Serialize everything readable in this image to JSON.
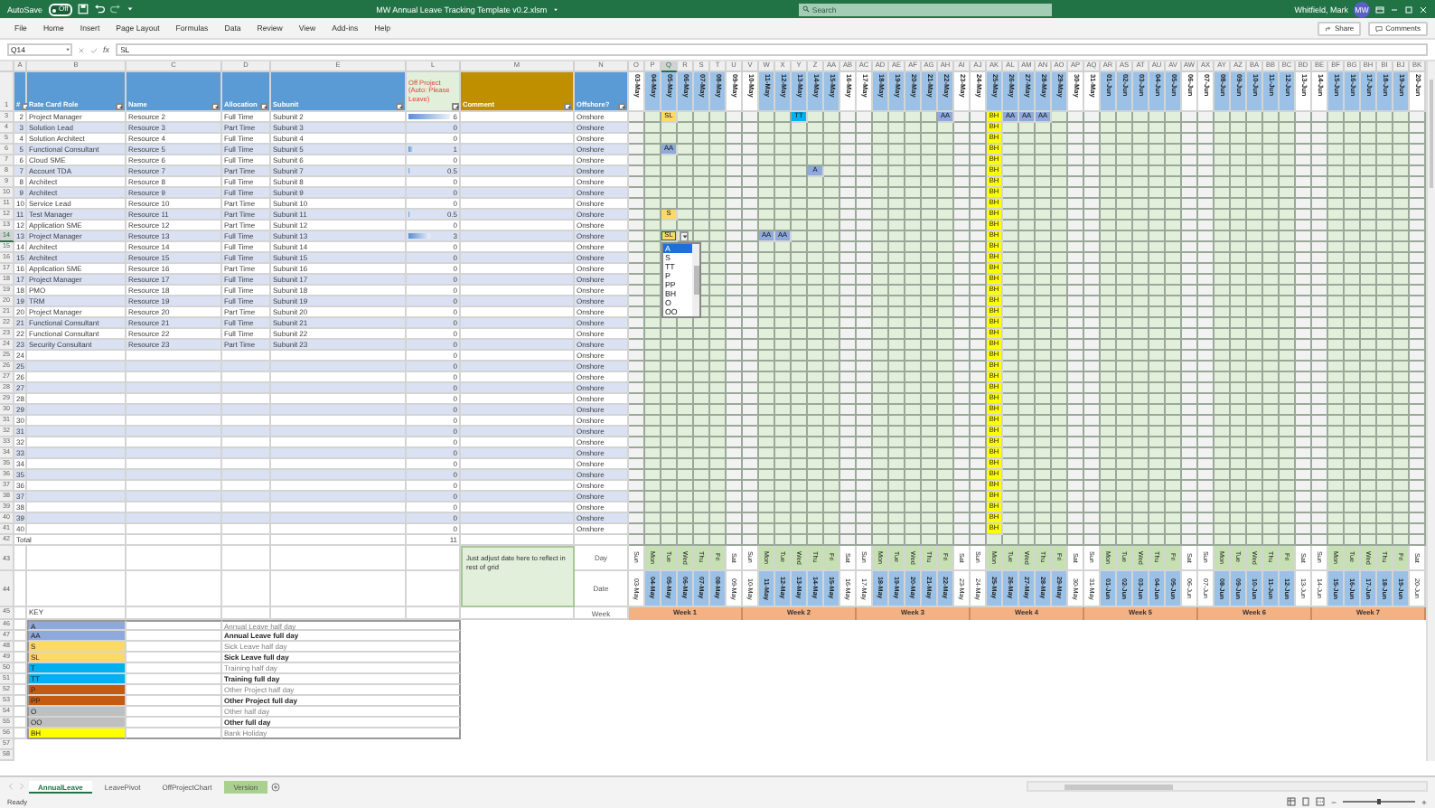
{
  "window": {
    "title": "MW Annual Leave Tracking Template v0.2.xlsm"
  },
  "autosave": {
    "label": "AutoSave",
    "value": "Off",
    "on": false
  },
  "search": {
    "placeholder": "Search"
  },
  "user": {
    "name": "Whitfield, Mark",
    "initials": "MW"
  },
  "menu": [
    "File",
    "Home",
    "Insert",
    "Page Layout",
    "Formulas",
    "Data",
    "Review",
    "View",
    "Add-ins",
    "Help"
  ],
  "share": "Share",
  "comments": "Comments",
  "formula_bar": {
    "name_box": "Q14",
    "fx": "fx",
    "value": "SL"
  },
  "corner_row": "1",
  "columns": [
    {
      "letter": "A",
      "title": "#"
    },
    {
      "letter": "B",
      "title": "Rate Card Role"
    },
    {
      "letter": "C",
      "title": "Name"
    },
    {
      "letter": "D",
      "title": "Allocation"
    },
    {
      "letter": "E",
      "title": "Subunit"
    },
    {
      "letter": "L",
      "title": "Off Project (Auto: Please Leave)"
    },
    {
      "letter": "M",
      "title": "Comment"
    },
    {
      "letter": "N",
      "title": "Offshore?"
    }
  ],
  "dates": [
    {
      "letter": "O",
      "date": "03-May",
      "weekend": true
    },
    {
      "letter": "P",
      "date": "04-May",
      "weekend": false
    },
    {
      "letter": "Q",
      "date": "05-May",
      "weekend": false
    },
    {
      "letter": "R",
      "date": "06-May",
      "weekend": false
    },
    {
      "letter": "S",
      "date": "07-May",
      "weekend": false
    },
    {
      "letter": "T",
      "date": "08-May",
      "weekend": false
    },
    {
      "letter": "U",
      "date": "09-May",
      "weekend": true
    },
    {
      "letter": "V",
      "date": "10-May",
      "weekend": true
    },
    {
      "letter": "W",
      "date": "11-May",
      "weekend": false
    },
    {
      "letter": "X",
      "date": "12-May",
      "weekend": false
    },
    {
      "letter": "Y",
      "date": "13-May",
      "weekend": false
    },
    {
      "letter": "Z",
      "date": "14-May",
      "weekend": false
    },
    {
      "letter": "AA",
      "date": "15-May",
      "weekend": false
    },
    {
      "letter": "AB",
      "date": "16-May",
      "weekend": true
    },
    {
      "letter": "AC",
      "date": "17-May",
      "weekend": true
    },
    {
      "letter": "AD",
      "date": "18-May",
      "weekend": false
    },
    {
      "letter": "AE",
      "date": "19-May",
      "weekend": false
    },
    {
      "letter": "AF",
      "date": "20-May",
      "weekend": false
    },
    {
      "letter": "AG",
      "date": "21-May",
      "weekend": false
    },
    {
      "letter": "AH",
      "date": "22-May",
      "weekend": false
    },
    {
      "letter": "AI",
      "date": "23-May",
      "weekend": true
    },
    {
      "letter": "AJ",
      "date": "24-May",
      "weekend": true
    },
    {
      "letter": "AK",
      "date": "25-May",
      "weekend": false
    },
    {
      "letter": "AL",
      "date": "26-May",
      "weekend": false
    },
    {
      "letter": "AM",
      "date": "27-May",
      "weekend": false
    },
    {
      "letter": "AN",
      "date": "28-May",
      "weekend": false
    },
    {
      "letter": "AO",
      "date": "29-May",
      "weekend": false
    },
    {
      "letter": "AP",
      "date": "30-May",
      "weekend": true
    },
    {
      "letter": "AQ",
      "date": "31-May",
      "weekend": true
    },
    {
      "letter": "AR",
      "date": "01-Jun",
      "weekend": false
    },
    {
      "letter": "AS",
      "date": "02-Jun",
      "weekend": false
    },
    {
      "letter": "AT",
      "date": "03-Jun",
      "weekend": false
    },
    {
      "letter": "AU",
      "date": "04-Jun",
      "weekend": false
    },
    {
      "letter": "AV",
      "date": "05-Jun",
      "weekend": false
    },
    {
      "letter": "AW",
      "date": "06-Jun",
      "weekend": true
    },
    {
      "letter": "AX",
      "date": "07-Jun",
      "weekend": true
    },
    {
      "letter": "AY",
      "date": "08-Jun",
      "weekend": false
    },
    {
      "letter": "AZ",
      "date": "09-Jun",
      "weekend": false
    },
    {
      "letter": "BA",
      "date": "10-Jun",
      "weekend": false
    },
    {
      "letter": "BB",
      "date": "11-Jun",
      "weekend": false
    },
    {
      "letter": "BC",
      "date": "12-Jun",
      "weekend": false
    },
    {
      "letter": "BD",
      "date": "13-Jun",
      "weekend": true
    },
    {
      "letter": "BE",
      "date": "14-Jun",
      "weekend": true
    },
    {
      "letter": "BF",
      "date": "15-Jun",
      "weekend": false
    },
    {
      "letter": "BG",
      "date": "16-Jun",
      "weekend": false
    },
    {
      "letter": "BH",
      "date": "17-Jun",
      "weekend": false
    },
    {
      "letter": "BI",
      "date": "18-Jun",
      "weekend": false
    },
    {
      "letter": "BJ",
      "date": "19-Jun",
      "weekend": false
    },
    {
      "letter": "BK",
      "date": "20-Jun",
      "weekend": true
    }
  ],
  "rows": [
    {
      "row": "3",
      "n": "2",
      "role": "Project Manager",
      "name": "Resource 2",
      "allocation": "Full Time",
      "subunit": "Subunit 2",
      "off": "6",
      "level": 0.85,
      "offshore": "Onshore",
      "leave": {
        "Q": {
          "code": "SL",
          "color": "#ffd966"
        },
        "Y": {
          "code": "TT",
          "color": "#00b0f0"
        },
        "AH": {
          "code": "AA",
          "color": "#8ea9db"
        },
        "AK": {
          "code": "BH",
          "color": "#ffff00"
        },
        "AL": {
          "code": "AA",
          "color": "#8ea9db"
        },
        "AM": {
          "code": "AA",
          "color": "#8ea9db"
        },
        "AN": {
          "code": "AA",
          "color": "#8ea9db"
        }
      }
    },
    {
      "row": "4",
      "n": "3",
      "role": "Solution Lead",
      "name": "Resource 3",
      "allocation": "Part Time",
      "subunit": "Subunit 3",
      "off": "0",
      "offshore": "Onshore",
      "leave": {
        "AK": {
          "code": "BH",
          "color": "#ffff00"
        }
      }
    },
    {
      "row": "5",
      "n": "4",
      "role": "Solution Architect",
      "name": "Resource 4",
      "allocation": "Full Time",
      "subunit": "Subunit 4",
      "off": "0",
      "offshore": "Onshore",
      "leave": {
        "AK": {
          "code": "BH",
          "color": "#ffff00"
        }
      }
    },
    {
      "row": "6",
      "n": "5",
      "role": "Functional Consultant",
      "name": "Resource 5",
      "allocation": "Full Time",
      "subunit": "Subunit 5",
      "off": "1",
      "level": 0.14,
      "offshore": "Onshore",
      "leave": {
        "Q": {
          "code": "AA",
          "color": "#8ea9db"
        },
        "AK": {
          "code": "BH",
          "color": "#ffff00"
        }
      }
    },
    {
      "row": "7",
      "n": "6",
      "role": "Cloud SME",
      "name": "Resource 6",
      "allocation": "Full Time",
      "subunit": "Subunit 6",
      "off": "0",
      "offshore": "Onshore",
      "leave": {
        "AK": {
          "code": "BH",
          "color": "#ffff00"
        }
      }
    },
    {
      "row": "8",
      "n": "7",
      "role": "Account TDA",
      "name": "Resource 7",
      "allocation": "Part Time",
      "subunit": "Subunit 7",
      "off": "0.5",
      "level": 0.07,
      "offshore": "Onshore",
      "leave": {
        "Z": {
          "code": "A",
          "color": "#8ea9db"
        },
        "AK": {
          "code": "BH",
          "color": "#ffff00"
        }
      }
    },
    {
      "row": "9",
      "n": "8",
      "role": "Architect",
      "name": "Resource 8",
      "allocation": "Full Time",
      "subunit": "Subunit 8",
      "off": "0",
      "offshore": "Onshore",
      "leave": {
        "AK": {
          "code": "BH",
          "color": "#ffff00"
        }
      }
    },
    {
      "row": "10",
      "n": "9",
      "role": "Architect",
      "name": "Resource 9",
      "allocation": "Full Time",
      "subunit": "Subunit 9",
      "off": "0",
      "offshore": "Onshore",
      "leave": {
        "AK": {
          "code": "BH",
          "color": "#ffff00"
        }
      }
    },
    {
      "row": "11",
      "n": "10",
      "role": "Service Lead",
      "name": "Resource 10",
      "allocation": "Part Time",
      "subunit": "Subunit 10",
      "off": "0",
      "offshore": "Onshore",
      "leave": {
        "AK": {
          "code": "BH",
          "color": "#ffff00"
        }
      }
    },
    {
      "row": "12",
      "n": "11",
      "role": "Test Manager",
      "name": "Resource 11",
      "allocation": "Part Time",
      "subunit": "Subunit 11",
      "off": "0.5",
      "level": 0.07,
      "offshore": "Onshore",
      "leave": {
        "Q": {
          "code": "S",
          "color": "#ffd966"
        },
        "AK": {
          "code": "BH",
          "color": "#ffff00"
        }
      }
    },
    {
      "row": "13",
      "n": "12",
      "role": "Application SME",
      "name": "Resource 12",
      "allocation": "Part Time",
      "subunit": "Subunit 12",
      "off": "0",
      "offshore": "Onshore",
      "leave": {
        "AK": {
          "code": "BH",
          "color": "#ffff00"
        }
      }
    },
    {
      "row": "14",
      "n": "13",
      "role": "Project Manager",
      "name": "Resource 13",
      "allocation": "Full Time",
      "subunit": "Subunit 13",
      "off": "3",
      "level": 0.45,
      "offshore": "Onshore",
      "leave": {
        "Q": {
          "code": "SL",
          "color": "#ffd966",
          "selected": true,
          "dropdown": [
            {
              "label": "A",
              "selected": true
            },
            {
              "label": "S",
              "selected": false
            },
            {
              "label": "TT",
              "selected": false
            },
            {
              "label": "P",
              "selected": false
            },
            {
              "label": "PP",
              "selected": false
            },
            {
              "label": "BH",
              "selected": false
            },
            {
              "label": "O",
              "selected": false
            },
            {
              "label": "OO",
              "selected": false
            }
          ]
        },
        "W": {
          "code": "AA",
          "color": "#8ea9db"
        },
        "X": {
          "code": "AA",
          "color": "#8ea9db"
        },
        "AK": {
          "code": "BH",
          "color": "#ffff00"
        }
      }
    },
    {
      "row": "15",
      "n": "14",
      "role": "Architect",
      "name": "Resource 14",
      "allocation": "Full Time",
      "subunit": "Subunit 14",
      "off": "0",
      "offshore": "Onshore",
      "leave": {
        "AK": {
          "code": "BH",
          "color": "#ffff00"
        }
      }
    },
    {
      "row": "16",
      "n": "15",
      "role": "Architect",
      "name": "Resource 15",
      "allocation": "Full Time",
      "subunit": "Subunit 15",
      "off": "0",
      "offshore": "Onshore",
      "leave": {
        "AK": {
          "code": "BH",
          "color": "#ffff00"
        }
      }
    },
    {
      "row": "17",
      "n": "16",
      "role": "Application SME",
      "name": "Resource 16",
      "allocation": "Part Time",
      "subunit": "Subunit 16",
      "off": "0",
      "offshore": "Onshore",
      "leave": {
        "AK": {
          "code": "BH",
          "color": "#ffff00"
        }
      }
    },
    {
      "row": "18",
      "n": "17",
      "role": "Project Manager",
      "name": "Resource 17",
      "allocation": "Full Time",
      "subunit": "Subunit 17",
      "off": "0",
      "offshore": "Onshore",
      "leave": {
        "AK": {
          "code": "BH",
          "color": "#ffff00"
        }
      }
    },
    {
      "row": "19",
      "n": "18",
      "role": "PMO",
      "name": "Resource 18",
      "allocation": "Full Time",
      "subunit": "Subunit 18",
      "off": "0",
      "offshore": "Onshore",
      "leave": {
        "AK": {
          "code": "BH",
          "color": "#ffff00"
        }
      }
    },
    {
      "row": "20",
      "n": "19",
      "role": "TRM",
      "name": "Resource 19",
      "allocation": "Full Time",
      "subunit": "Subunit 19",
      "off": "0",
      "offshore": "Onshore",
      "leave": {
        "AK": {
          "code": "BH",
          "color": "#ffff00"
        }
      }
    },
    {
      "row": "21",
      "n": "20",
      "role": "Project Manager",
      "name": "Resource 20",
      "allocation": "Part Time",
      "subunit": "Subunit 20",
      "off": "0",
      "offshore": "Onshore",
      "leave": {
        "AK": {
          "code": "BH",
          "color": "#ffff00"
        }
      }
    },
    {
      "row": "22",
      "n": "21",
      "role": "Functional Consultant",
      "name": "Resource 21",
      "allocation": "Full Time",
      "subunit": "Subunit 21",
      "off": "0",
      "offshore": "Onshore",
      "leave": {
        "AK": {
          "code": "BH",
          "color": "#ffff00"
        }
      }
    },
    {
      "row": "23",
      "n": "22",
      "role": "Functional Consultant",
      "name": "Resource 22",
      "allocation": "Full Time",
      "subunit": "Subunit 22",
      "off": "0",
      "offshore": "Onshore",
      "leave": {
        "AK": {
          "code": "BH",
          "color": "#ffff00"
        }
      }
    },
    {
      "row": "24",
      "n": "23",
      "role": "Security Consultant",
      "name": "Resource 23",
      "allocation": "Part Time",
      "subunit": "Subunit 23",
      "off": "0",
      "offshore": "Onshore",
      "leave": {
        "AK": {
          "code": "BH",
          "color": "#ffff00"
        }
      }
    },
    {
      "row": "25",
      "n": "24",
      "off": "0",
      "offshore": "Onshore",
      "leave": {
        "AK": {
          "code": "BH",
          "color": "#ffff00"
        }
      }
    },
    {
      "row": "26",
      "n": "25",
      "off": "0",
      "offshore": "Onshore",
      "leave": {
        "AK": {
          "code": "BH",
          "color": "#ffff00"
        }
      }
    },
    {
      "row": "27",
      "n": "26",
      "off": "0",
      "offshore": "Onshore",
      "leave": {
        "AK": {
          "code": "BH",
          "color": "#ffff00"
        }
      }
    },
    {
      "row": "28",
      "n": "27",
      "off": "0",
      "offshore": "Onshore",
      "leave": {
        "AK": {
          "code": "BH",
          "color": "#ffff00"
        }
      }
    },
    {
      "row": "29",
      "n": "28",
      "off": "0",
      "offshore": "Onshore",
      "leave": {
        "AK": {
          "code": "BH",
          "color": "#ffff00"
        }
      }
    },
    {
      "row": "30",
      "n": "29",
      "off": "0",
      "offshore": "Onshore",
      "leave": {
        "AK": {
          "code": "BH",
          "color": "#ffff00"
        }
      }
    },
    {
      "row": "31",
      "n": "30",
      "off": "0",
      "offshore": "Onshore",
      "leave": {
        "AK": {
          "code": "BH",
          "color": "#ffff00"
        }
      }
    },
    {
      "row": "32",
      "n": "31",
      "off": "0",
      "offshore": "Onshore",
      "leave": {
        "AK": {
          "code": "BH",
          "color": "#ffff00"
        }
      }
    },
    {
      "row": "33",
      "n": "32",
      "off": "0",
      "offshore": "Onshore",
      "leave": {
        "AK": {
          "code": "BH",
          "color": "#ffff00"
        }
      }
    },
    {
      "row": "34",
      "n": "33",
      "off": "0",
      "offshore": "Onshore",
      "leave": {
        "AK": {
          "code": "BH",
          "color": "#ffff00"
        }
      }
    },
    {
      "row": "35",
      "n": "34",
      "off": "0",
      "offshore": "Onshore",
      "leave": {
        "AK": {
          "code": "BH",
          "color": "#ffff00"
        }
      }
    },
    {
      "row": "36",
      "n": "35",
      "off": "0",
      "offshore": "Onshore",
      "leave": {
        "AK": {
          "code": "BH",
          "color": "#ffff00"
        }
      }
    },
    {
      "row": "37",
      "n": "36",
      "off": "0",
      "offshore": "Onshore",
      "leave": {
        "AK": {
          "code": "BH",
          "color": "#ffff00"
        }
      }
    },
    {
      "row": "38",
      "n": "37",
      "off": "0",
      "offshore": "Onshore",
      "leave": {
        "AK": {
          "code": "BH",
          "color": "#ffff00"
        }
      }
    },
    {
      "row": "39",
      "n": "38",
      "off": "0",
      "offshore": "Onshore",
      "leave": {
        "AK": {
          "code": "BH",
          "color": "#ffff00"
        }
      }
    },
    {
      "row": "40",
      "n": "39",
      "off": "0",
      "offshore": "Onshore",
      "leave": {
        "AK": {
          "code": "BH",
          "color": "#ffff00"
        }
      }
    },
    {
      "row": "41",
      "n": "40",
      "off": "0",
      "offshore": "Onshore",
      "leave": {
        "AK": {
          "code": "BH",
          "color": "#ffff00"
        }
      }
    }
  ],
  "total": {
    "row": "42",
    "label": "Total",
    "value": "11"
  },
  "footer": {
    "rows": [
      "43",
      "44",
      "45"
    ],
    "note": "Just adjust date here to reflect in rest of grid",
    "day_label": "Day",
    "date_label": "Date",
    "week_label": "Week",
    "days": [
      {
        "day": "Sun",
        "weekend": true
      },
      {
        "day": "Mon",
        "weekend": false
      },
      {
        "day": "Tue",
        "weekend": false
      },
      {
        "day": "Wed",
        "weekend": false
      },
      {
        "day": "Thu",
        "weekend": false
      },
      {
        "day": "Fri",
        "weekend": false
      },
      {
        "day": "Sat",
        "weekend": true
      },
      {
        "day": "Sun",
        "weekend": true
      },
      {
        "day": "Mon",
        "weekend": false
      },
      {
        "day": "Tue",
        "weekend": false
      },
      {
        "day": "Wed",
        "weekend": false
      },
      {
        "day": "Thu",
        "weekend": false
      },
      {
        "day": "Fri",
        "weekend": false
      },
      {
        "day": "Sat",
        "weekend": true
      },
      {
        "day": "Sun",
        "weekend": true
      },
      {
        "day": "Mon",
        "weekend": false
      },
      {
        "day": "Tue",
        "weekend": false
      },
      {
        "day": "Wed",
        "weekend": false
      },
      {
        "day": "Thu",
        "weekend": false
      },
      {
        "day": "Fri",
        "weekend": false
      },
      {
        "day": "Sat",
        "weekend": true
      },
      {
        "day": "Sun",
        "weekend": true
      },
      {
        "day": "Mon",
        "weekend": false
      },
      {
        "day": "Tue",
        "weekend": false
      },
      {
        "day": "Wed",
        "weekend": false
      },
      {
        "day": "Thu",
        "weekend": false
      },
      {
        "day": "Fri",
        "weekend": false
      },
      {
        "day": "Sat",
        "weekend": true
      },
      {
        "day": "Sun",
        "weekend": true
      },
      {
        "day": "Mon",
        "weekend": false
      },
      {
        "day": "Tue",
        "weekend": false
      },
      {
        "day": "Wed",
        "weekend": false
      },
      {
        "day": "Thu",
        "weekend": false
      },
      {
        "day": "Fri",
        "weekend": false
      },
      {
        "day": "Sat",
        "weekend": true
      },
      {
        "day": "Sun",
        "weekend": true
      },
      {
        "day": "Mon",
        "weekend": false
      },
      {
        "day": "Tue",
        "weekend": false
      },
      {
        "day": "Wed",
        "weekend": false
      },
      {
        "day": "Thu",
        "weekend": false
      },
      {
        "day": "Fri",
        "weekend": false
      },
      {
        "day": "Sat",
        "weekend": true
      },
      {
        "day": "Sun",
        "weekend": true
      },
      {
        "day": "Mon",
        "weekend": false
      },
      {
        "day": "Tue",
        "weekend": false
      },
      {
        "day": "Wed",
        "weekend": false
      },
      {
        "day": "Thu",
        "weekend": false
      },
      {
        "day": "Fri",
        "weekend": false
      },
      {
        "day": "Sat",
        "weekend": true
      }
    ],
    "dates": [
      "03-May",
      "04-May",
      "05-May",
      "06-May",
      "07-May",
      "08-May",
      "09-May",
      "10-May",
      "11-May",
      "12-May",
      "13-May",
      "14-May",
      "15-May",
      "16-May",
      "17-May",
      "18-May",
      "19-May",
      "20-May",
      "21-May",
      "22-May",
      "23-May",
      "24-May",
      "25-May",
      "26-May",
      "27-May",
      "28-May",
      "29-May",
      "30-May",
      "31-May",
      "01-Jun",
      "02-Jun",
      "03-Jun",
      "04-Jun",
      "05-Jun",
      "06-Jun",
      "07-Jun",
      "08-Jun",
      "09-Jun",
      "10-Jun",
      "11-Jun",
      "12-Jun",
      "13-Jun",
      "14-Jun",
      "15-Jun",
      "16-Jun",
      "17-Jun",
      "18-Jun",
      "19-Jun",
      "20-Jun"
    ],
    "weeks": [
      "Week 1",
      "Week 2",
      "Week 3",
      "Week 4",
      "Week 5",
      "Week 6",
      "Week 7"
    ]
  },
  "key": {
    "label": "KEY",
    "items": [
      {
        "row": "46",
        "code": "A",
        "color": "#8ea9db",
        "label": "Annual Leave half day",
        "full": false
      },
      {
        "row": "47",
        "code": "AA",
        "color": "#8ea9db",
        "label": "Annual Leave full day",
        "full": true
      },
      {
        "row": "48",
        "code": "S",
        "color": "#ffd966",
        "label": "Sick Leave half day",
        "full": false
      },
      {
        "row": "49",
        "code": "SL",
        "color": "#ffd966",
        "label": "Sick Leave full day",
        "full": true
      },
      {
        "row": "50",
        "code": "T",
        "color": "#00b0f0",
        "label": "Training half day",
        "full": false
      },
      {
        "row": "51",
        "code": "TT",
        "color": "#00b0f0",
        "label": "Training full day",
        "full": true
      },
      {
        "row": "52",
        "code": "P",
        "color": "#c55a11",
        "label": "Other Project half day",
        "full": false
      },
      {
        "row": "53",
        "code": "PP",
        "color": "#c55a11",
        "label": "Other Project full day",
        "full": true
      },
      {
        "row": "54",
        "code": "O",
        "color": "#bfbfbf",
        "label": "Other half day",
        "full": false
      },
      {
        "row": "55",
        "code": "OO",
        "color": "#bfbfbf",
        "label": "Other full day",
        "full": true
      },
      {
        "row": "56",
        "code": "BH",
        "color": "#ffff00",
        "label": "Bank Holiday",
        "full": false
      }
    ]
  },
  "blank_rows": [
    "57",
    "58"
  ],
  "sheets": [
    {
      "label": "AnnualLeave",
      "selected": true
    },
    {
      "label": "LeavePivot",
      "selected": false
    },
    {
      "label": "OffProjectChart",
      "selected": false
    },
    {
      "label": "Version",
      "selected": false,
      "color": "#a9d08e"
    }
  ],
  "status": {
    "text": "Ready"
  },
  "zoom": {
    "level": 0.5
  }
}
